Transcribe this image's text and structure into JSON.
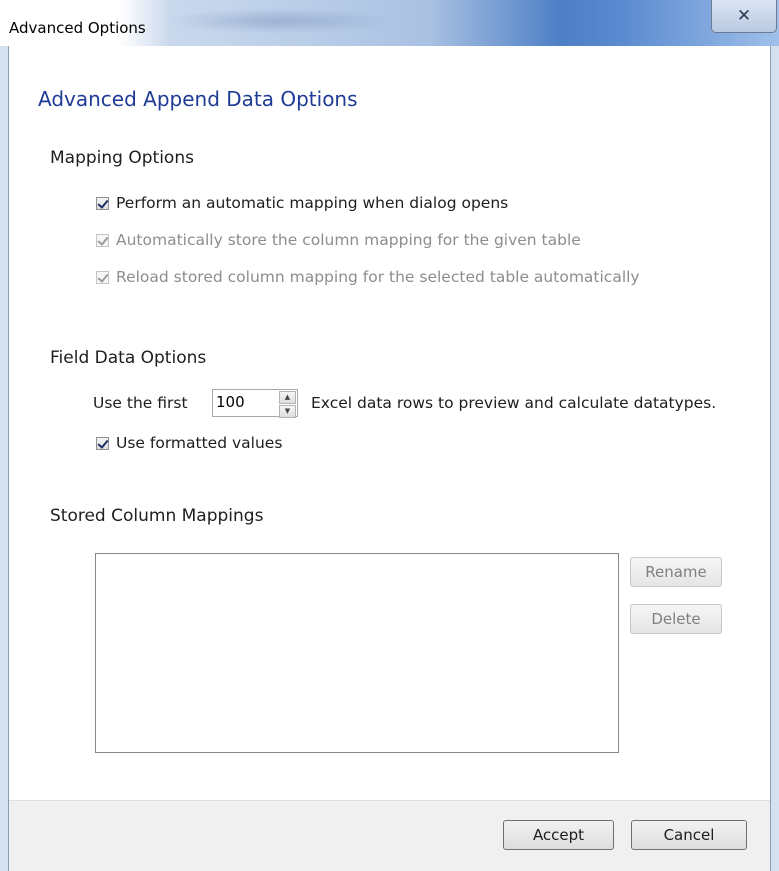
{
  "window": {
    "title": "Advanced Options",
    "close_glyph": "✕"
  },
  "heading": "Advanced Append Data Options",
  "mapping_options": {
    "title": "Mapping Options",
    "items": [
      {
        "label": "Perform an automatic mapping when dialog opens",
        "checked": true,
        "enabled": true
      },
      {
        "label": "Automatically store the column mapping for the given table",
        "checked": true,
        "enabled": false
      },
      {
        "label": "Reload stored column mapping for the selected table automatically",
        "checked": true,
        "enabled": false
      }
    ]
  },
  "field_data_options": {
    "title": "Field Data Options",
    "use_first_label": "Use the first",
    "rows_value": "100",
    "rows_suffix": "Excel data rows to preview and calculate datatypes.",
    "formatted_values": {
      "label": "Use formatted values",
      "checked": true
    }
  },
  "stored_mappings": {
    "title": "Stored Column Mappings",
    "rename_label": "Rename",
    "delete_label": "Delete"
  },
  "footer": {
    "accept_label": "Accept",
    "cancel_label": "Cancel"
  }
}
